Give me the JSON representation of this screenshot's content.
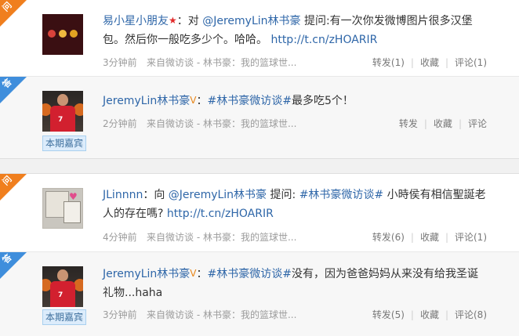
{
  "posts": [
    {
      "kind_label": "问",
      "user": "易小星小朋友",
      "verify_icon": "star-icon",
      "colon": "：",
      "pre": "对 ",
      "mention": "@JeremyLin林书豪",
      "text": " 提问:有一次你发微博图片很多汉堡包。然后你一般吃多少个。哈哈。 ",
      "link": "http://t.cn/zHOARIR",
      "time": "3分钟前",
      "source": "来自微访谈 - 林书豪：我的篮球世...",
      "forward": "转发(1)",
      "favorite": "收藏",
      "comment": "评论(1)"
    },
    {
      "kind_label": "答",
      "user": "JeremyLin林书豪",
      "verify_icon": "verified-v-icon",
      "colon": "：",
      "hashtag": "#林书豪微访谈#",
      "text": "最多吃5个！",
      "time": "2分钟前",
      "source": "来自微访谈 - 林书豪：我的篮球世...",
      "forward": "转发",
      "favorite": "收藏",
      "comment": "评论",
      "badge": "本期嘉宾"
    },
    {
      "kind_label": "问",
      "user": "JLinnnn",
      "colon": "：",
      "pre": "向 ",
      "mention": "@JeremyLin林书豪",
      "text_a": " 提问: ",
      "hashtag": "#林书豪微访谈#",
      "text_b": " 小時侯有相信聖誕老人的存在嗎? ",
      "link": "http://t.cn/zHOARIR",
      "time": "4分钟前",
      "source": "来自微访谈 - 林书豪：我的篮球世...",
      "forward": "转发(6)",
      "favorite": "收藏",
      "comment": "评论(1)"
    },
    {
      "kind_label": "答",
      "user": "JeremyLin林书豪",
      "verify_icon": "verified-v-icon",
      "colon": "：",
      "hashtag": "#林书豪微访谈#",
      "text": "没有，因为爸爸妈妈从来没有给我圣诞礼物...haha",
      "time": "3分钟前",
      "source": "来自微访谈 - 林书豪：我的篮球世...",
      "forward": "转发(5)",
      "favorite": "收藏",
      "comment": "评论(8)",
      "badge": "本期嘉宾"
    }
  ],
  "colors": {
    "link": "#2e66a8",
    "ask_corner": "#f07f1e",
    "answer_corner": "#3f8edc",
    "meta": "#9b9b9b"
  }
}
